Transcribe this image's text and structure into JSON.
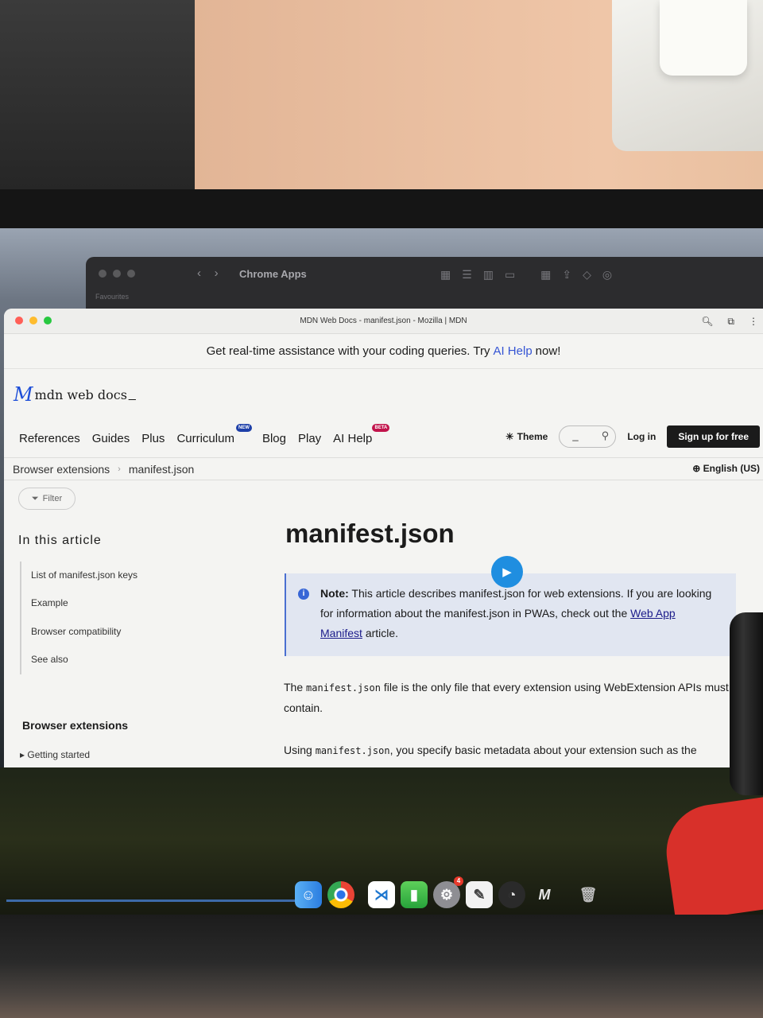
{
  "finder": {
    "title": "Chrome Apps",
    "favourites": "Favourites"
  },
  "window": {
    "title": "MDN Web Docs - manifest.json - Mozilla | MDN"
  },
  "banner": {
    "text_before": "Get real-time assistance with your coding queries. Try",
    "link": "AI Help",
    "text_after": "now!"
  },
  "logo": {
    "mark": "M",
    "text": "mdn web docs",
    "cursor": "_"
  },
  "nav": {
    "items": [
      "References",
      "Guides",
      "Plus",
      "Curriculum",
      "Blog",
      "Play",
      "AI Help"
    ],
    "badge_new": "NEW",
    "badge_beta": "BETA",
    "theme": "Theme",
    "search_placeholder": "_",
    "login": "Log in",
    "signup": "Sign up for free"
  },
  "breadcrumb": {
    "items": [
      "Browser extensions",
      "manifest.json"
    ],
    "language": "English (US)"
  },
  "sidebar": {
    "filter": "Filter",
    "toc_title": "In this article",
    "toc_items": [
      "List of manifest.json keys",
      "Example",
      "Browser compatibility",
      "See also"
    ],
    "section_heading": "Browser extensions",
    "section_item": "Getting started"
  },
  "article": {
    "title": "manifest.json",
    "note_label": "Note:",
    "note_text": "This article describes manifest.json for web extensions. If you are looking for information about the manifest.json in PWAs, check out the",
    "note_link": "Web App Manifest",
    "note_end": "article.",
    "para1_code": "manifest.json",
    "para1_before": "The",
    "para1_after": "file is the only file that every extension using WebExtension APIs must contain.",
    "para2_before": "Using",
    "para2_code": "manifest.json",
    "para2_after": ", you specify basic metadata about your extension such as the"
  },
  "dock": {
    "icons": [
      "finder-icon",
      "chrome-icon",
      "vscode-icon",
      "numbers-icon",
      "settings-icon",
      "textedit-icon",
      "activity-icon",
      "mdn-icon",
      "trash-icon"
    ],
    "settings_badge": "4"
  }
}
